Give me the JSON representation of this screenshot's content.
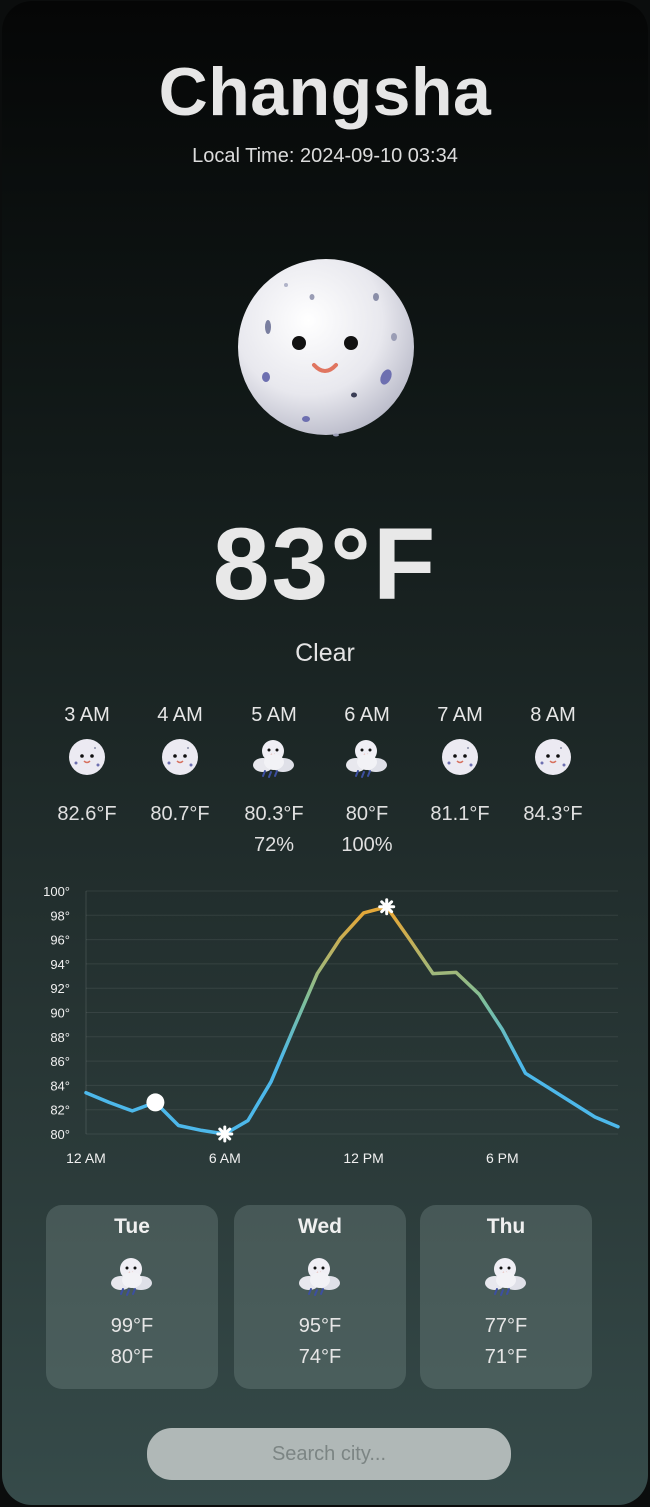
{
  "city": "Changsha",
  "local_time": "Local Time: 2024-09-10 03:34",
  "current": {
    "temp": "83°F",
    "condition": "Clear",
    "icon": "smiling-moon-icon"
  },
  "hourly": [
    {
      "time": "3 AM",
      "temp": "82.6°F",
      "precip": "",
      "icon": "moon"
    },
    {
      "time": "4 AM",
      "temp": "80.7°F",
      "precip": "",
      "icon": "moon"
    },
    {
      "time": "5 AM",
      "temp": "80.3°F",
      "precip": "72%",
      "icon": "rain-cloud"
    },
    {
      "time": "6 AM",
      "temp": "80°F",
      "precip": "100%",
      "icon": "rain-cloud"
    },
    {
      "time": "7 AM",
      "temp": "81.1°F",
      "precip": "",
      "icon": "moon"
    },
    {
      "time": "8 AM",
      "temp": "84.3°F",
      "precip": "",
      "icon": "moon"
    }
  ],
  "chart_data": {
    "type": "line",
    "title": "",
    "xlabel": "",
    "ylabel": "",
    "x": [
      0,
      1,
      2,
      3,
      4,
      5,
      6,
      7,
      8,
      9,
      10,
      11,
      12,
      13,
      14,
      15,
      16,
      17,
      18,
      19,
      20,
      21,
      22,
      23
    ],
    "values": [
      83.4,
      82.6,
      81.9,
      82.6,
      80.7,
      80.3,
      80.0,
      81.1,
      84.3,
      88.8,
      93.2,
      96.1,
      98.2,
      98.7,
      96.0,
      93.2,
      93.3,
      91.5,
      88.6,
      85.0,
      83.8,
      82.6,
      81.4,
      80.6
    ],
    "ylim": [
      80,
      100
    ],
    "yticks": [
      "80°",
      "82°",
      "84°",
      "86°",
      "88°",
      "90°",
      "92°",
      "94°",
      "96°",
      "98°",
      "100°"
    ],
    "xticks": [
      {
        "value": 0,
        "label": "12 AM"
      },
      {
        "value": 6,
        "label": "6 AM"
      },
      {
        "value": 12,
        "label": "12 PM"
      },
      {
        "value": 18,
        "label": "6 PM"
      }
    ],
    "current_marker": 3,
    "min_marker": 6,
    "max_marker": 13,
    "colors": {
      "cool": "#4db8ea",
      "mid": "#7fbf9a",
      "warm": "#e3a83a"
    },
    "grid": true
  },
  "daily": [
    {
      "day": "Tue",
      "high": "99°F",
      "low": "80°F",
      "icon": "rain-cloud"
    },
    {
      "day": "Wed",
      "high": "95°F",
      "low": "74°F",
      "icon": "rain-cloud"
    },
    {
      "day": "Thu",
      "high": "77°F",
      "low": "71°F",
      "icon": "rain-cloud"
    }
  ],
  "search": {
    "placeholder": "Search city..."
  }
}
